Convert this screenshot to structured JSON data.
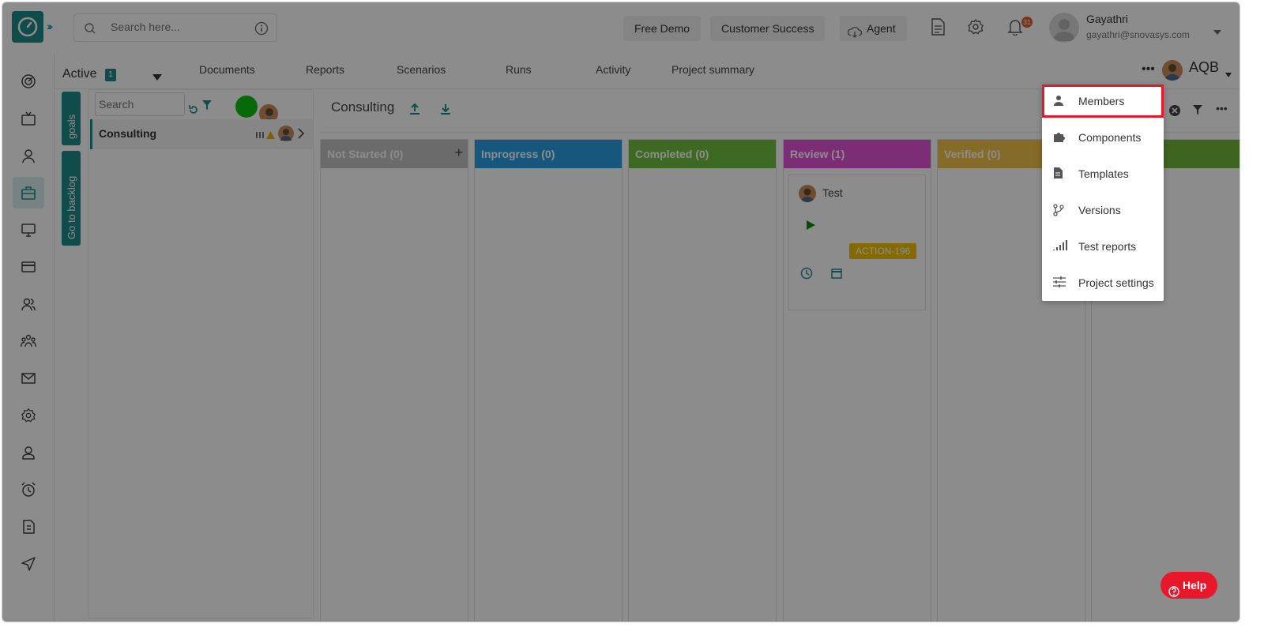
{
  "header": {
    "search_placeholder": "Search here...",
    "buttons": {
      "free_demo": "Free Demo",
      "customer_success": "Customer Success",
      "agent": "Agent"
    },
    "notification_count": "31",
    "user": {
      "name": "Gayathri",
      "email": "gayathri@snovasys.com"
    }
  },
  "tabs_bar": {
    "status_label": "Active",
    "status_count": "1",
    "tabs": [
      "Documents",
      "Reports",
      "Scenarios",
      "Runs",
      "Activity",
      "Project summary"
    ],
    "project_code": "AQB"
  },
  "side_strips": {
    "goals": "goals",
    "backlog": "Go to backlog"
  },
  "left_panel": {
    "search_placeholder": "Search",
    "project_name": "Consulting"
  },
  "board": {
    "title": "Consulting",
    "columns": [
      {
        "label": "Not Started (0)",
        "color": "#c3c3c3"
      },
      {
        "label": "Inprogress (0)",
        "color": "#2b9fe6"
      },
      {
        "label": "Completed (0)",
        "color": "#6fbf40"
      },
      {
        "label": "Review (1)",
        "color": "#e054d6"
      },
      {
        "label": "Verified (0)",
        "color": "#f2c44a"
      },
      {
        "label": "",
        "color": "#72b83b"
      }
    ],
    "card": {
      "title": "Test",
      "tag": "ACTION-196"
    }
  },
  "dropdown": {
    "items": [
      "Members",
      "Components",
      "Templates",
      "Versions",
      "Test reports",
      "Project settings"
    ],
    "highlighted": "Members"
  },
  "help_label": "Help",
  "colors": {
    "brand": "#1e8a8a",
    "highlight": "#e8182a"
  }
}
